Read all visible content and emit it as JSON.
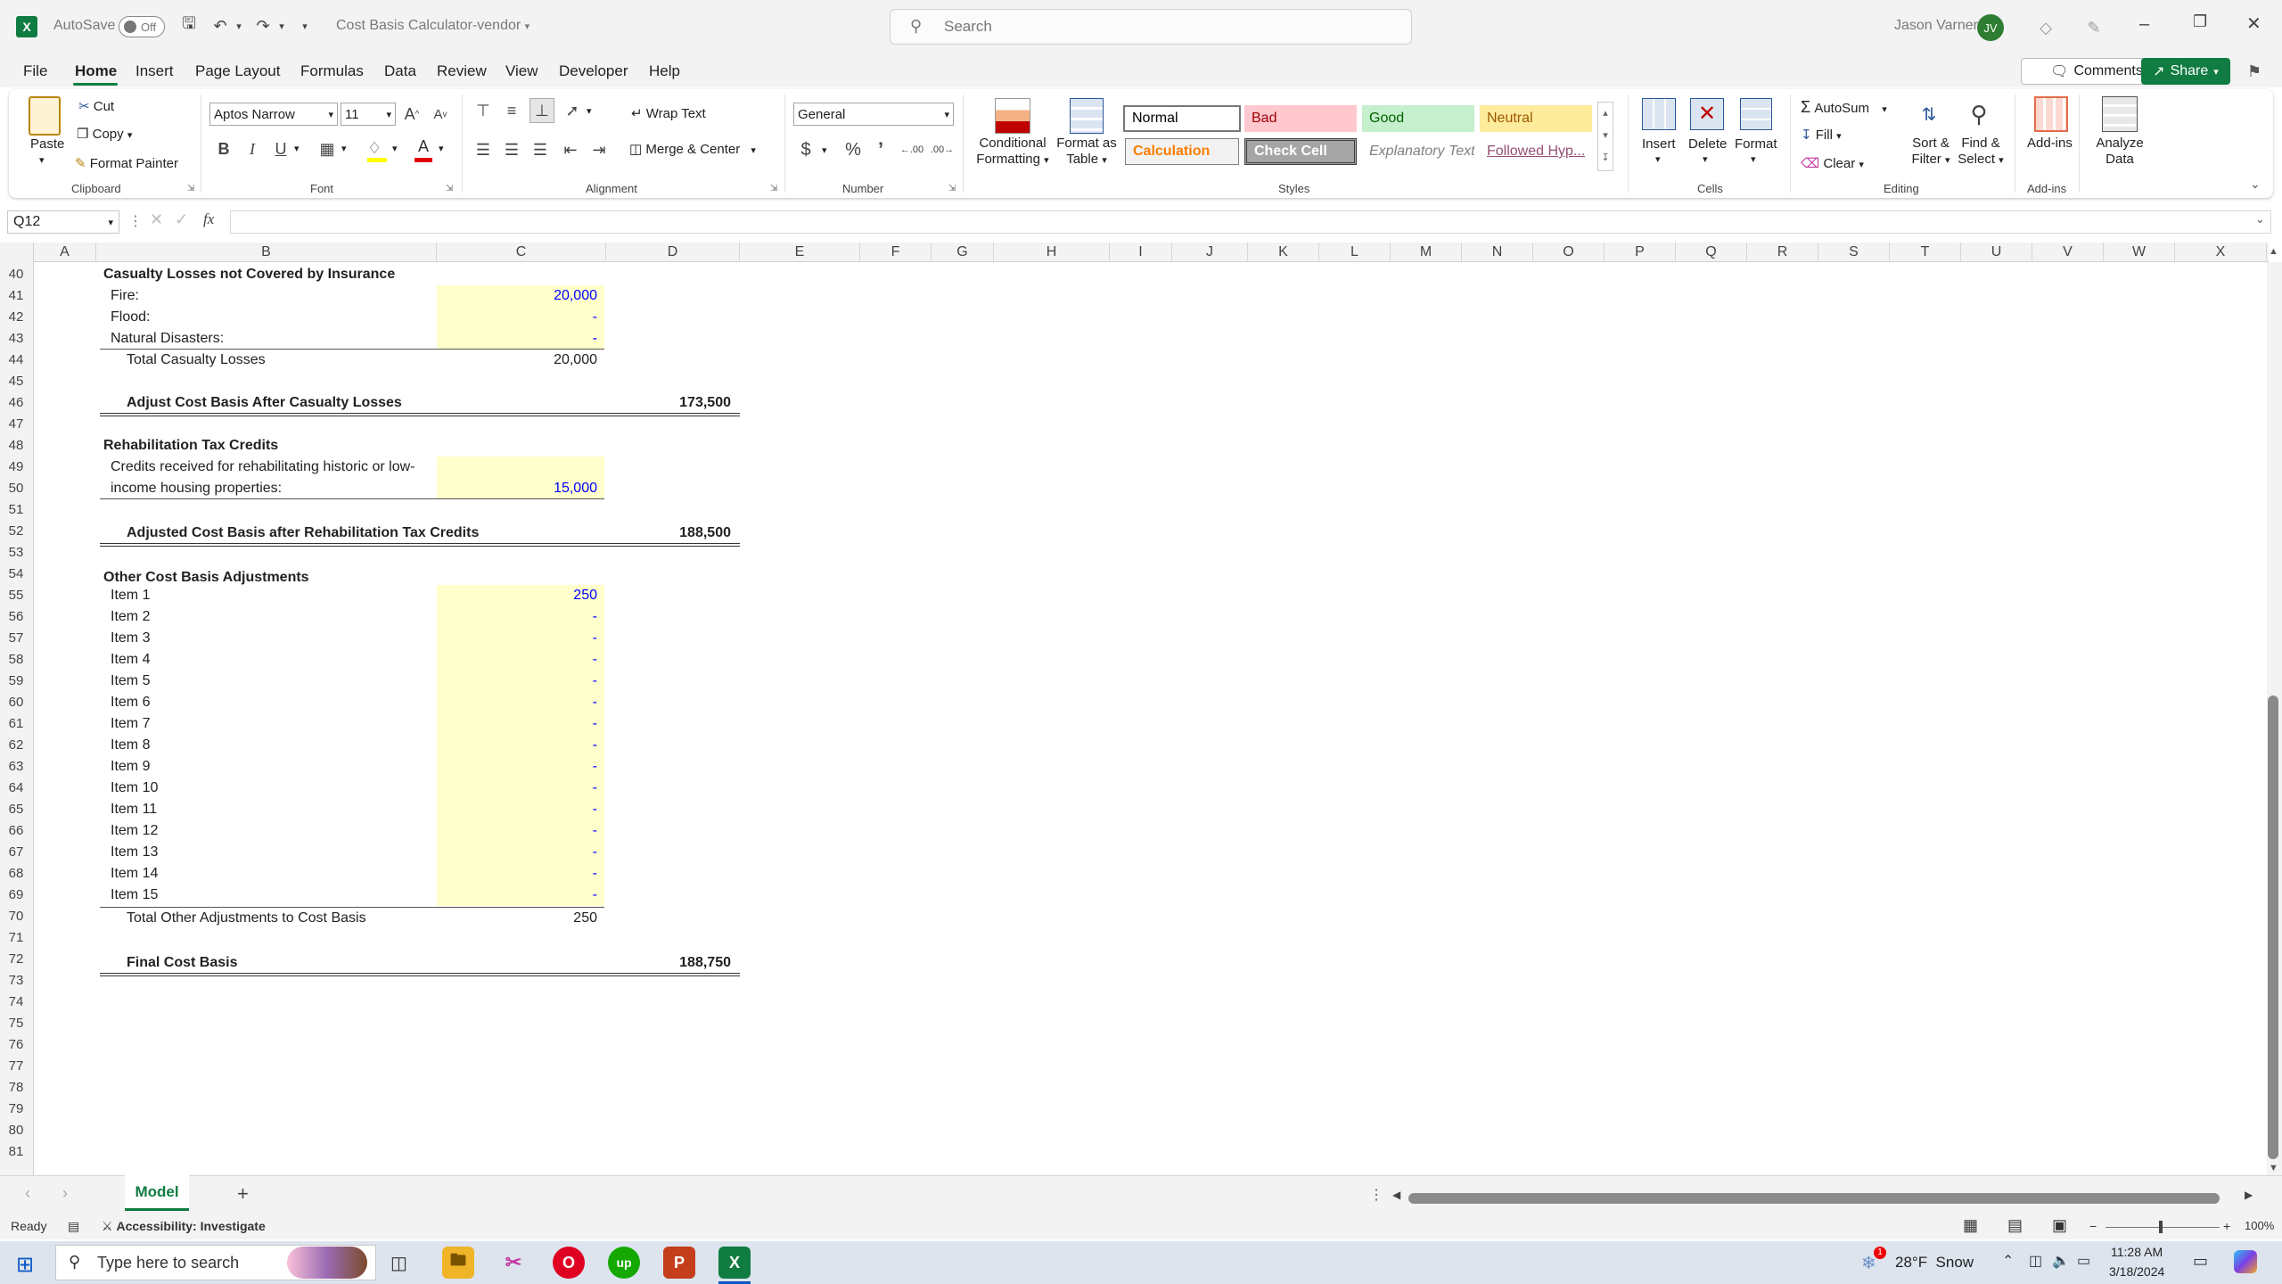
{
  "titlebar": {
    "autosave": "AutoSave",
    "toggle": "Off",
    "doc_title": "Cost Basis Calculator-vendor",
    "search_placeholder": "Search",
    "user_name": "Jason Varner",
    "user_initials": "JV"
  },
  "menu": [
    "File",
    "Home",
    "Insert",
    "Page Layout",
    "Formulas",
    "Data",
    "Review",
    "View",
    "Developer",
    "Help"
  ],
  "menu_right": {
    "comments": "Comments",
    "share": "Share"
  },
  "ribbon": {
    "clipboard": {
      "paste": "Paste",
      "cut": "Cut",
      "copy": "Copy",
      "format_painter": "Format Painter",
      "group": "Clipboard"
    },
    "font": {
      "name": "Aptos Narrow",
      "size": "11",
      "group": "Font"
    },
    "alignment": {
      "wrap": "Wrap Text",
      "merge": "Merge & Center",
      "group": "Alignment"
    },
    "number": {
      "format": "General",
      "group": "Number"
    },
    "styles": {
      "cond_l1": "Conditional",
      "cond_l2": "Formatting",
      "fat_l1": "Format as",
      "fat_l2": "Table",
      "normal": "Normal",
      "bad": "Bad",
      "good": "Good",
      "neutral": "Neutral",
      "calculation": "Calculation",
      "check_cell": "Check Cell",
      "explanatory": "Explanatory Text",
      "followed": "Followed Hyp...",
      "group": "Styles"
    },
    "cells": {
      "insert": "Insert",
      "delete": "Delete",
      "format": "Format",
      "group": "Cells"
    },
    "editing": {
      "autosum": "AutoSum",
      "fill": "Fill",
      "clear": "Clear",
      "sort_l1": "Sort &",
      "sort_l2": "Filter",
      "find_l1": "Find &",
      "find_l2": "Select",
      "group": "Editing"
    },
    "addins": {
      "addins": "Add-ins",
      "analyze_l1": "Analyze",
      "analyze_l2": "Data",
      "group": "Add-ins"
    },
    "colors": {
      "accent": "#107c41",
      "bad_bg": "#ffc7ce",
      "good_bg": "#c6efce",
      "neutral_bg": "#ffeb9c",
      "calc_text": "#fa7d00",
      "input_fill": "#ffffcc"
    }
  },
  "formula_bar": {
    "namebox": "Q12",
    "fx": "fx",
    "content": ""
  },
  "columns": [
    "A",
    "B",
    "C",
    "D",
    "E",
    "F",
    "G",
    "H",
    "I",
    "J",
    "K",
    "L",
    "M",
    "N",
    "O",
    "P",
    "Q",
    "R",
    "S",
    "T",
    "U",
    "V",
    "W",
    "X"
  ],
  "rows": [
    "40",
    "41",
    "42",
    "43",
    "44",
    "45",
    "46",
    "47",
    "48",
    "49",
    "50",
    "51",
    "52",
    "53",
    "54",
    "55",
    "56",
    "57",
    "58",
    "59",
    "60",
    "61",
    "62",
    "63",
    "64",
    "65",
    "66",
    "67",
    "68",
    "69",
    "70",
    "71",
    "72",
    "73",
    "74",
    "75",
    "76",
    "77",
    "78",
    "79",
    "80",
    "81"
  ],
  "sheet": {
    "casualty_header": "Casualty Losses not Covered by Insurance",
    "fire_label": "Fire:",
    "fire_val": "20,000",
    "flood_label": "Flood:",
    "flood_val": "-",
    "nat_label": "Natural Disasters:",
    "nat_val": "-",
    "total_cas_label": "Total Casualty Losses",
    "total_cas_val": "20,000",
    "adj_cas_label": "Adjust Cost Basis After Casualty Losses",
    "adj_cas_val": "173,500",
    "rehab_header": "Rehabilitation Tax Credits",
    "rehab_l1": "Credits received for rehabilitating historic or low-",
    "rehab_l2": "income housing properties:",
    "rehab_val": "15,000",
    "adj_rehab_label": "Adjusted Cost Basis after Rehabilitation Tax Credits",
    "adj_rehab_val": "188,500",
    "other_header": "Other Cost Basis Adjustments",
    "items": [
      {
        "label": "Item 1",
        "value": "250"
      },
      {
        "label": "Item 2",
        "value": "-"
      },
      {
        "label": "Item 3",
        "value": "-"
      },
      {
        "label": "Item 4",
        "value": "-"
      },
      {
        "label": "Item 5",
        "value": "-"
      },
      {
        "label": "Item 6",
        "value": "-"
      },
      {
        "label": "Item 7",
        "value": "-"
      },
      {
        "label": "Item 8",
        "value": "-"
      },
      {
        "label": "Item 9",
        "value": "-"
      },
      {
        "label": "Item 10",
        "value": "-"
      },
      {
        "label": "Item 11",
        "value": "-"
      },
      {
        "label": "Item 12",
        "value": "-"
      },
      {
        "label": "Item 13",
        "value": "-"
      },
      {
        "label": "Item 14",
        "value": "-"
      },
      {
        "label": "Item 15",
        "value": "-"
      }
    ],
    "total_other_label": "Total Other Adjustments to Cost Basis",
    "total_other_val": "250",
    "final_label": "Final Cost Basis",
    "final_val": "188,750"
  },
  "tabs": {
    "sheet": "Model",
    "add": "+"
  },
  "status": {
    "ready": "Ready",
    "accessibility": "Accessibility: Investigate",
    "zoom": "100%"
  },
  "taskbar": {
    "search": "Type here to search",
    "weather": "28°F  Snow",
    "time": "11:28 AM",
    "date": "3/18/2024",
    "badge": "1"
  }
}
